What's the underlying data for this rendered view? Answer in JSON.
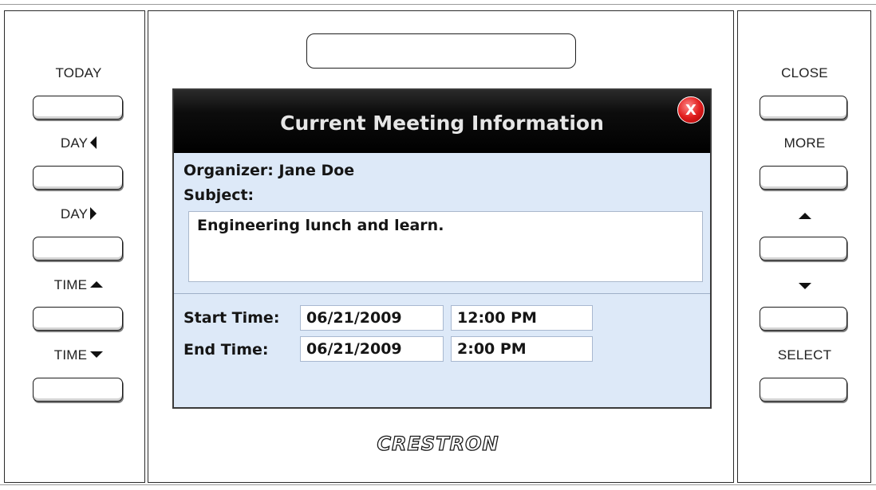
{
  "left_buttons": [
    {
      "label": "TODAY",
      "arrow": ""
    },
    {
      "label": "DAY",
      "arrow": "left"
    },
    {
      "label": "DAY",
      "arrow": "right"
    },
    {
      "label": "TIME",
      "arrow": "up"
    },
    {
      "label": "TIME",
      "arrow": "down"
    }
  ],
  "right_buttons": [
    {
      "label": "CLOSE",
      "arrow": ""
    },
    {
      "label": "MORE",
      "arrow": ""
    },
    {
      "label": "",
      "arrow": "up"
    },
    {
      "label": "",
      "arrow": "down"
    },
    {
      "label": "SELECT",
      "arrow": ""
    }
  ],
  "dialog": {
    "title": "Current Meeting Information",
    "close_glyph": "X",
    "organizer_label": "Organizer:",
    "organizer_value": "Jane Doe",
    "subject_label": "Subject:",
    "subject_value": "Engineering lunch and learn.",
    "start_label": "Start Time:",
    "start_date": "06/21/2009",
    "start_time": "12:00 PM",
    "end_label": "End Time:",
    "end_date": "06/21/2009",
    "end_time": "2:00 PM"
  },
  "brand": "CRESTRON",
  "colors": {
    "title_bar": "#000000",
    "dialog_bg": "#dde9f8",
    "close_button": "#e11e1e"
  },
  "icons": {
    "close": "close-icon",
    "arrow_left": "triangle-left-icon",
    "arrow_right": "triangle-right-icon",
    "arrow_up": "triangle-up-icon",
    "arrow_down": "triangle-down-icon"
  }
}
